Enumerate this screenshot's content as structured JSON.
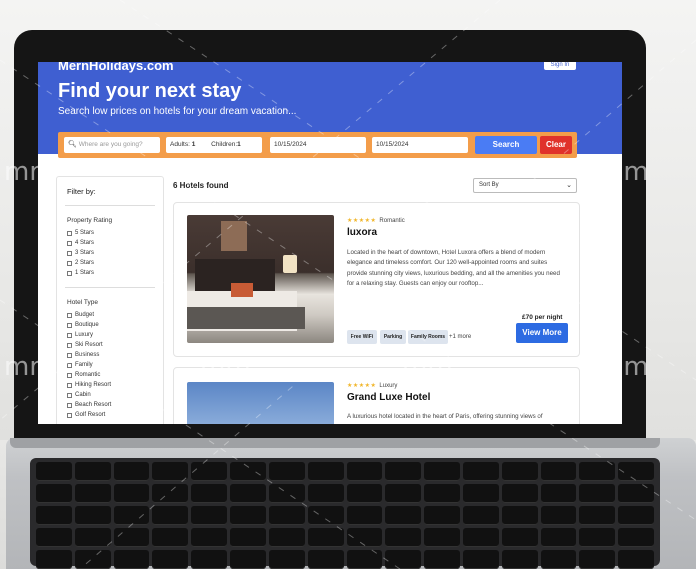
{
  "header": {
    "brand": "MernHolidays.com",
    "signin_label": "Sign In",
    "title": "Find your next stay",
    "subtitle": "Search low prices on hotels for your dream vacation..."
  },
  "search": {
    "destination_placeholder": "Where are you going?",
    "adults_label": "Adults:",
    "adults_value": "1",
    "children_label": "Children:",
    "children_value": "1",
    "checkin": "10/15/2024",
    "checkout": "10/15/2024",
    "search_label": "Search",
    "clear_label": "Clear"
  },
  "filters": {
    "title": "Filter by:",
    "rating_title": "Property Rating",
    "ratings": [
      "5 Stars",
      "4 Stars",
      "3 Stars",
      "2 Stars",
      "1 Stars"
    ],
    "type_title": "Hotel Type",
    "types": [
      "Budget",
      "Boutique",
      "Luxury",
      "Ski Resort",
      "Business",
      "Family",
      "Romantic",
      "Hiking Resort",
      "Cabin",
      "Beach Resort",
      "Golf Resort"
    ]
  },
  "results": {
    "count_label": "6 Hotels found",
    "sort_label": "Sort By",
    "hotels": [
      {
        "stars": "★★★★★",
        "type": "Romantic",
        "name": "luxora",
        "description": "Located in the heart of downtown, Hotel Luxora offers a blend of modern elegance and timeless comfort. Our 120 well-appointed rooms and suites provide stunning city views, luxurious bedding, and all the amenities you need for a relaxing stay. Guests can enjoy our rooftop...",
        "price": "£70 per night",
        "view_label": "View More",
        "facilities": [
          "Free WiFi",
          "Parking",
          "Family Rooms"
        ],
        "more_label": "+1 more"
      },
      {
        "stars": "★★★★★",
        "type": "Luxury",
        "name": "Grand Luxe Hotel",
        "description": "A luxurious hotel located in the heart of Paris, offering stunning views of"
      }
    ]
  },
  "watermark": {
    "text": "m"
  },
  "colors": {
    "hero": "#3f5fd1",
    "search_bar": "#f39d4a",
    "search_button": "#4a7cf4",
    "clear_button": "#e0322b",
    "view_button": "#2d6be2",
    "stars": "#f1b62b"
  }
}
